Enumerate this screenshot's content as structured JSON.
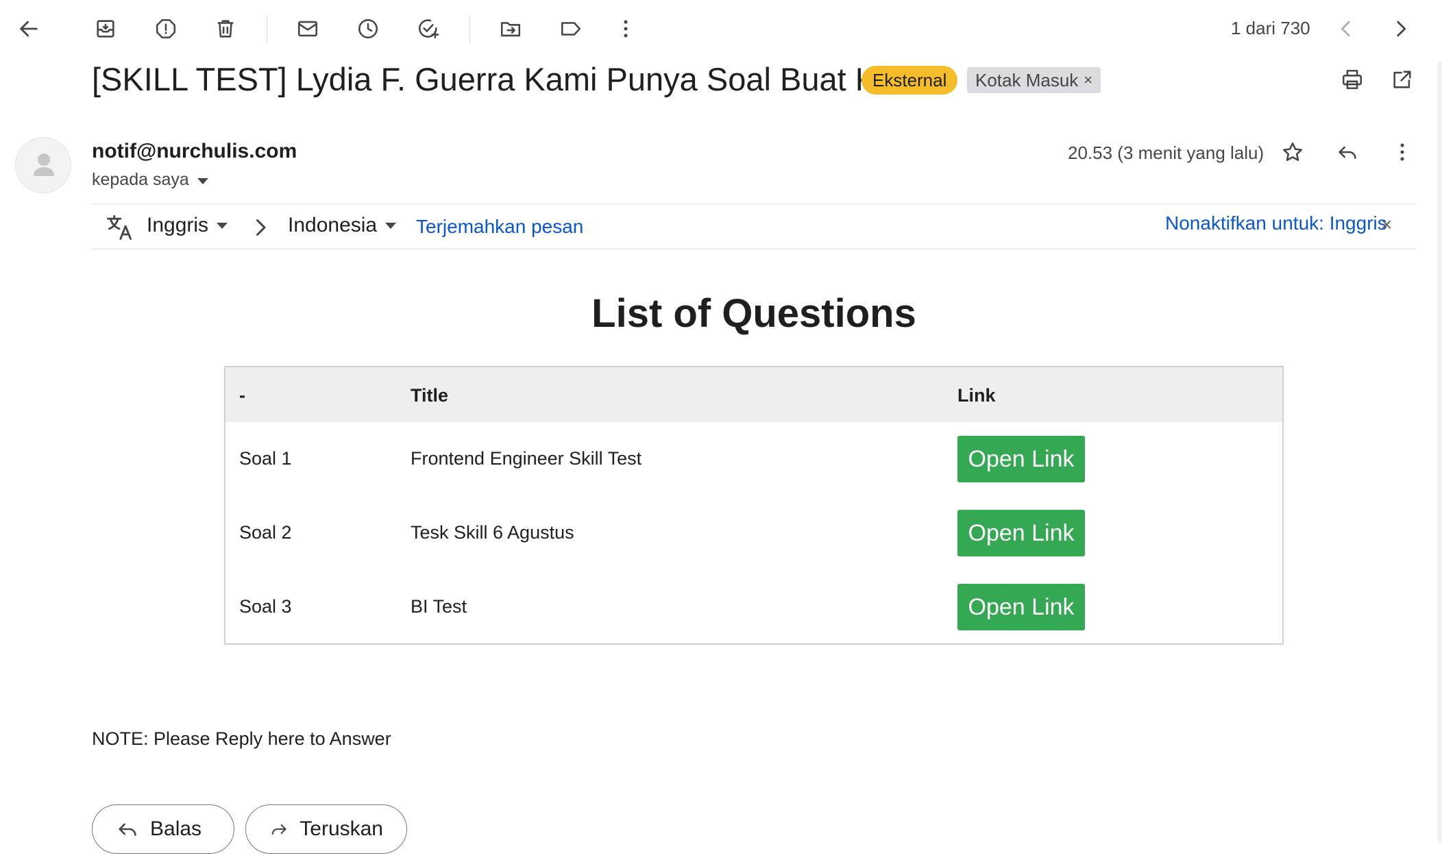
{
  "toolbar": {
    "back": "back-icon",
    "actions": [
      "archive-icon",
      "report-spam-icon",
      "delete-icon",
      "mark-unread-icon",
      "snooze-icon",
      "add-task-icon",
      "move-to-icon",
      "label-icon",
      "more-icon"
    ],
    "pager": "1 dari 730"
  },
  "email": {
    "subject": "[SKILL TEST] Lydia F. Guerra Kami Punya Soal Buat Kamu",
    "badge_external": "Eksternal",
    "badge_inbox": "Kotak Masuk",
    "badge_inbox_close": "×",
    "sender": "notif@nurchulis.com",
    "recipient": "kepada saya",
    "time": "20.53 (3 menit yang lalu)"
  },
  "translate": {
    "from_lang": "Inggris",
    "to_lang": "Indonesia",
    "translate_link": "Terjemahkan pesan",
    "disable_link": "Nonaktifkan untuk: Inggris",
    "close": "×"
  },
  "body": {
    "heading": "List of Questions",
    "table": {
      "headers": [
        "-",
        "Title",
        "Link"
      ],
      "rows": [
        {
          "num": "Soal 1",
          "title": "Frontend Engineer Skill Test",
          "link_label": "Open Link"
        },
        {
          "num": "Soal 2",
          "title": "Tesk Skill 6 Agustus",
          "link_label": "Open Link"
        },
        {
          "num": "Soal 3",
          "title": "BI Test",
          "link_label": "Open Link"
        }
      ]
    },
    "note": "NOTE: Please Reply here to Answer"
  },
  "reply_actions": {
    "reply": "Balas",
    "forward": "Teruskan"
  },
  "colors": {
    "external_badge": "#f6bd2a",
    "open_link_button": "#34a853",
    "link_blue": "#0b57d0"
  }
}
